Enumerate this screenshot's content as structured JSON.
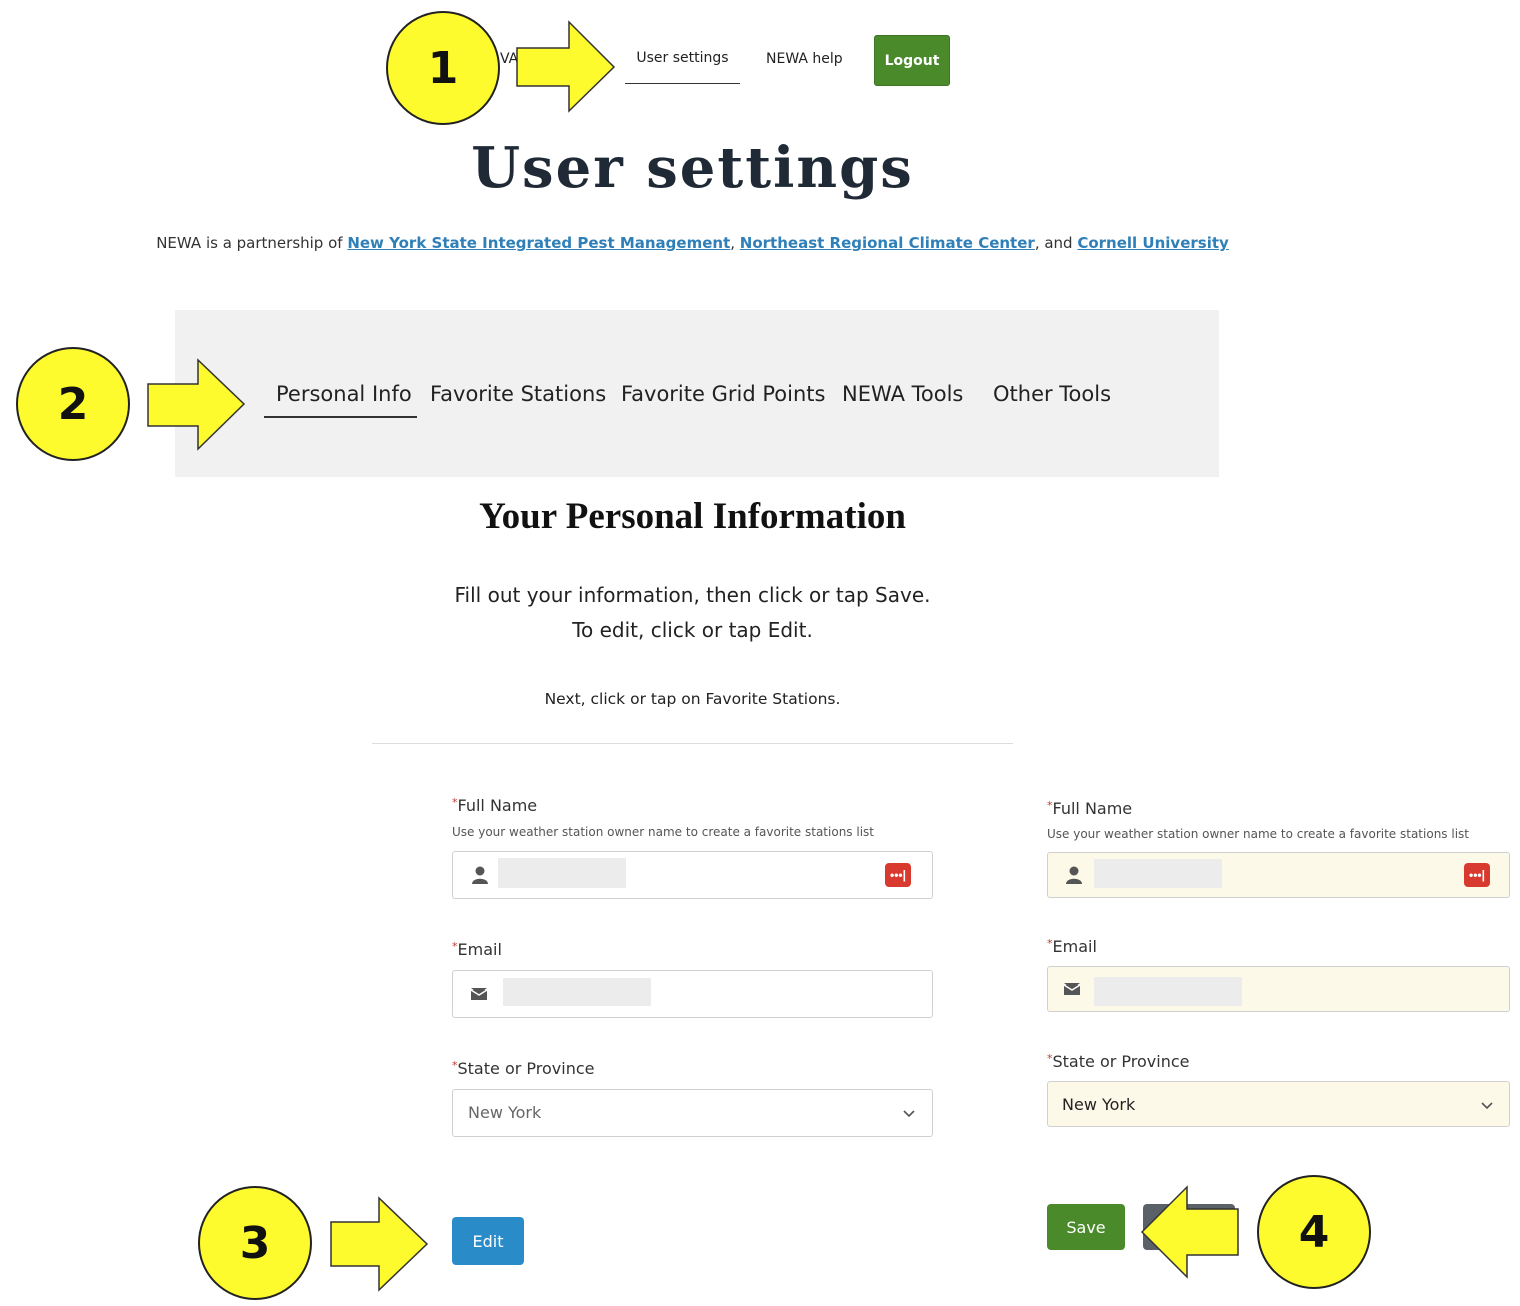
{
  "nav": {
    "brand_fragment": "VA",
    "user_settings": "User settings",
    "help": "NEWA help",
    "logout": "Logout"
  },
  "page_title": "User settings",
  "partnership": {
    "prefix": "NEWA is a partnership of ",
    "link1": "New York State Integrated Pest Management",
    "sep1": ", ",
    "link2": "Northeast Regional Climate Center",
    "sep2": ", and ",
    "link3": "Cornell University"
  },
  "tabs": [
    "Personal Info",
    "Favorite Stations",
    "Favorite Grid Points",
    "NEWA Tools",
    "Other Tools"
  ],
  "section_title": "Your Personal Information",
  "instructions": {
    "line1": "Fill out your information, then click or tap Save.",
    "line2": "To edit, click or tap Edit.",
    "line3": "Next, click or tap on Favorite Stations."
  },
  "form_left": {
    "full_name_label": "Full Name",
    "full_name_hint": "Use your weather station owner name to create a favorite stations list",
    "email_label": "Email",
    "state_label": "State or Province",
    "state_value": "New York",
    "required_mark": "*",
    "edit_button": "Edit"
  },
  "form_right": {
    "full_name_label": "Full Name",
    "full_name_hint": "Use your weather station owner name to create a favorite stations list",
    "email_label": "Email",
    "state_label": "State or Province",
    "state_value": "New York",
    "required_mark": "*",
    "save_button": "Save"
  },
  "icons": {
    "password_manager": "•••|"
  },
  "callouts": [
    "1",
    "2",
    "3",
    "4"
  ],
  "colors": {
    "logout_green": "#4a8a2a",
    "edit_blue": "#2a8bc9",
    "link_blue": "#2f7fb8",
    "callout_yellow": "#fdfa2d",
    "filled_field": "#fdf9e8"
  }
}
